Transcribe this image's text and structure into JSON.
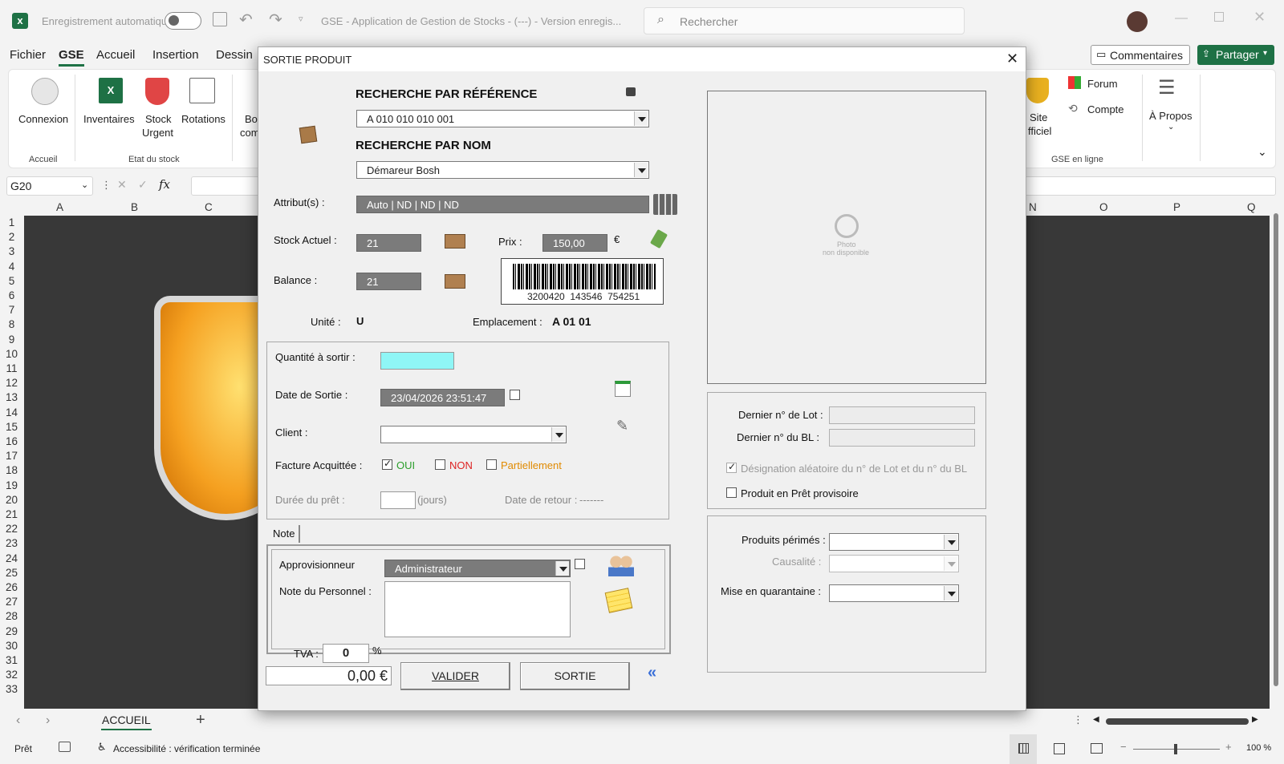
{
  "titlebar": {
    "autosave": "Enregistrement automatique",
    "doc_title": "GSE - Application de Gestion de Stocks - (---) - Version enregis...",
    "search_placeholder": "Rechercher"
  },
  "menu": [
    "Fichier",
    "GSE",
    "Accueil",
    "Insertion",
    "Dessin"
  ],
  "ribbon": {
    "buttons": [
      "Connexion",
      "Inventaires",
      "Stock",
      "Urgent",
      "Rotations",
      "Bo",
      "com"
    ],
    "groups": [
      "Accueil",
      "Etat du stock",
      "GSE en ligne"
    ],
    "right": {
      "site": "Site",
      "officiel": "fficiel",
      "forum": "Forum",
      "compte": "Compte",
      "apropos": "À Propos"
    },
    "commentaires": "Commentaires",
    "partager": "Partager"
  },
  "formula": {
    "namebox": "G20",
    "fx": "fx"
  },
  "columns": [
    "A",
    "B",
    "C",
    "N",
    "O",
    "P",
    "Q"
  ],
  "rows": [
    "1",
    "2",
    "3",
    "4",
    "5",
    "6",
    "7",
    "8",
    "9",
    "10",
    "11",
    "12",
    "13",
    "14",
    "15",
    "16",
    "17",
    "18",
    "19",
    "20",
    "21",
    "22",
    "23",
    "24",
    "25",
    "26",
    "27",
    "28",
    "29",
    "30",
    "31",
    "32",
    "33"
  ],
  "sheet_tab": "ACCUEIL",
  "status": {
    "ready": "Prêt",
    "accessibility": "Accessibilité : vérification terminée",
    "zoom": "100 %"
  },
  "dialog": {
    "title": "SORTIE PRODUIT",
    "search_ref_label": "RECHERCHE PAR RÉFÉRENCE",
    "ref_value": "A 010 010 010 001",
    "search_name_label": "RECHERCHE PAR NOM",
    "name_value": "Démareur Bosh",
    "attr_label": "Attribut(s) :",
    "attr_value": "Auto | ND | ND | ND",
    "stock_label": "Stock Actuel :",
    "stock_value": "21",
    "price_label": "Prix :",
    "price_value": "150,00",
    "currency": "€",
    "balance_label": "Balance :",
    "balance_value": "21",
    "barcode_text": "3200420  143546  754251",
    "unit_label": "Unité :",
    "unit_value": "U",
    "location_label": "Emplacement :",
    "location_value": "A 01 01",
    "qty_label": "Quantité à sortir :",
    "date_label": "Date de Sortie :",
    "date_value": "23/04/2026 23:51:47",
    "client_label": "Client :",
    "invoice_label": "Facture Acquittée :",
    "oui": "OUI",
    "non": "NON",
    "partiel": "Partiellement",
    "loan_label": "Durée du prêt :",
    "days": "(jours)",
    "return_label": "Date de retour :",
    "return_value": "-------",
    "note_tab": "Note",
    "supplier_label": "Approvisionneur",
    "supplier_value": "Administrateur",
    "staff_note_label": "Note du Personnel :",
    "vat_label": "TVA :",
    "vat_value": "0",
    "percent": "%",
    "total": "0,00 €",
    "validate": "VALIDER",
    "exit": "SORTIE",
    "photo_1": "Photo",
    "photo_2": "non disponible",
    "lot_label": "Dernier n° de Lot :",
    "bl_label": "Dernier n° du BL :",
    "random_label": "Désignation aléatoire du n° de Lot et du n° du BL",
    "loan_product_label": "Produit en Prêt provisoire",
    "expired_label": "Produits périmés :",
    "cause_label": "Causalité :",
    "quarantine_label": "Mise en quarantaine :"
  },
  "colors": {
    "excel_green": "#1e7145",
    "qty_field": "#8ff6f6",
    "oui": "#2a9d2a",
    "non": "#d22",
    "partiel": "#e08a00"
  }
}
